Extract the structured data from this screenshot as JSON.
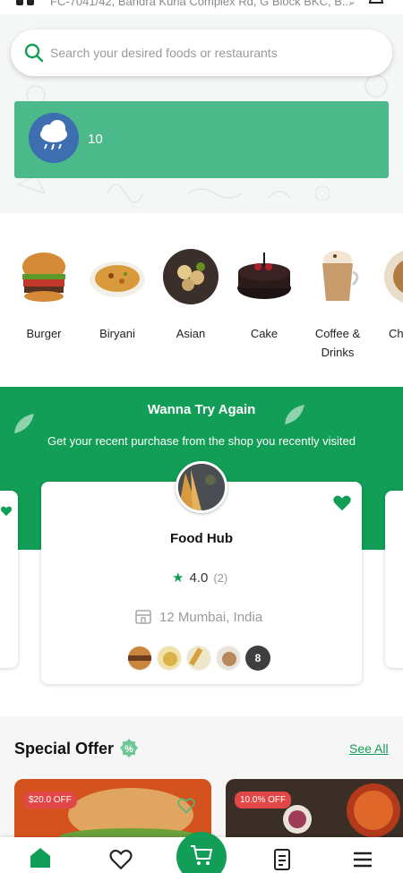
{
  "header": {
    "address": "FC-7041/42, Bandra Kurla Complex Rd, G Block BKC, B..."
  },
  "search": {
    "placeholder": "Search your desired foods or restaurants"
  },
  "weather": {
    "temperature": "10",
    "icon": "rain-cloud-icon"
  },
  "categories": [
    {
      "label": "Burger"
    },
    {
      "label": "Biryani"
    },
    {
      "label": "Asian"
    },
    {
      "label": "Cake"
    },
    {
      "label": "Coffee & Drinks"
    },
    {
      "label": "Ch"
    }
  ],
  "recent": {
    "title": "Wanna Try Again",
    "subtitle": "Get your recent purchase from the shop you recently visited",
    "shop_name": "Food Hub",
    "rating": "4.0",
    "rating_count": "(2)",
    "location": "12 Mumbai, India",
    "more_items": "8"
  },
  "special_offer": {
    "title": "Special Offer",
    "see_all": "See All",
    "offers": [
      {
        "badge": "$20.0 OFF"
      },
      {
        "badge": "10.0% OFF"
      }
    ]
  },
  "colors": {
    "primary": "#129e56",
    "weather_bg": "#4bb98a",
    "badge": "#e24747"
  }
}
